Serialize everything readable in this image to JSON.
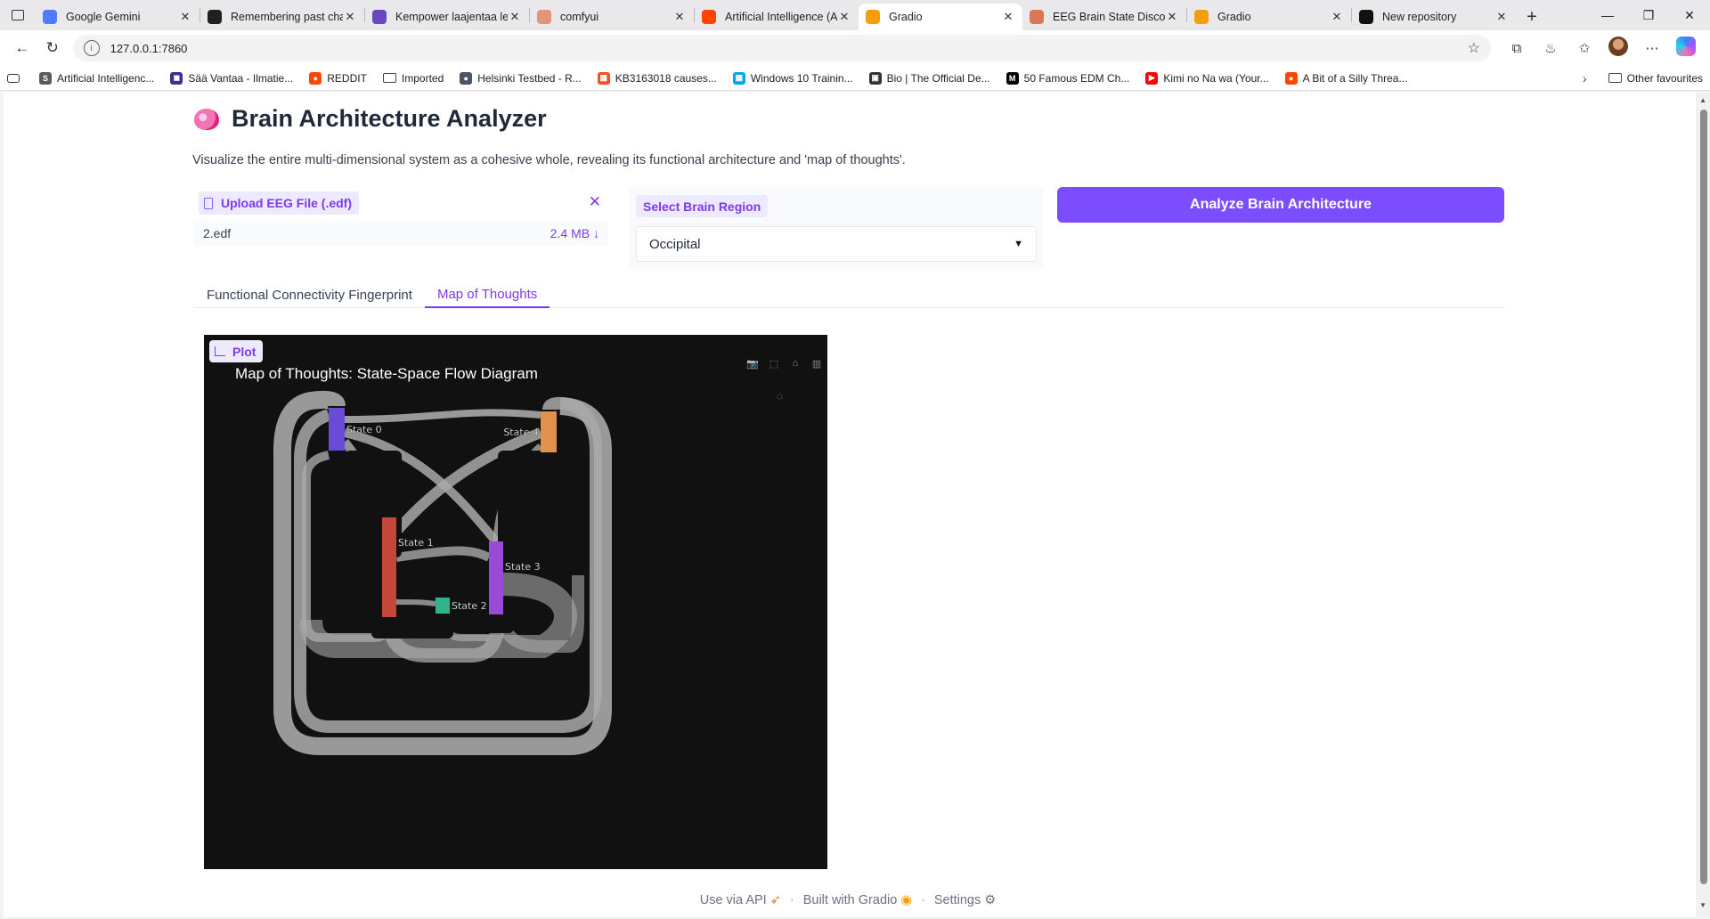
{
  "browser": {
    "tabs": [
      {
        "label": "Google Gemini",
        "icon": "gemini-icon",
        "color": "#4f7cff"
      },
      {
        "label": "Remembering past cha",
        "icon": "openai-icon",
        "color": "#202020"
      },
      {
        "label": "Kempower laajentaa le",
        "icon": "kempower-icon",
        "color": "#6b46c1"
      },
      {
        "label": "comfyui",
        "icon": "comfyui-icon",
        "color": "#e4947a"
      },
      {
        "label": "Artificial Intelligence (A",
        "icon": "reddit-icon",
        "color": "#ff4500"
      },
      {
        "label": "Gradio",
        "icon": "gradio-icon",
        "color": "#f59e0b",
        "active": true
      },
      {
        "label": "EEG Brain State Discove",
        "icon": "claude-icon",
        "color": "#d97757"
      },
      {
        "label": "Gradio",
        "icon": "gradio-icon",
        "color": "#f59e0b"
      },
      {
        "label": "New repository",
        "icon": "github-icon",
        "color": "#111111"
      }
    ],
    "url": "127.0.0.1:7860",
    "bookmarks": [
      {
        "label": "Artificial Intelligenc...",
        "color": "#5b5b5b",
        "glyph": "S"
      },
      {
        "label": "Sää Vantaa - Ilmatie...",
        "color": "#3b2f8f",
        "glyph": "◼"
      },
      {
        "label": "REDDIT",
        "color": "#ff4500",
        "glyph": "●"
      },
      {
        "label": "Imported",
        "color": "folder",
        "glyph": ""
      },
      {
        "label": "Helsinki Testbed - R...",
        "color": "#4b5563",
        "glyph": "●"
      },
      {
        "label": "KB3163018 causes...",
        "color": "#f25022",
        "glyph": "▦"
      },
      {
        "label": "Windows 10 Trainin...",
        "color": "#00a4ef",
        "glyph": "▦"
      },
      {
        "label": "Bio | The Official De...",
        "color": "#333333",
        "glyph": "▣"
      },
      {
        "label": "50 Famous EDM Ch...",
        "color": "#000000",
        "glyph": "M"
      },
      {
        "label": "Kimi no Na wa (Your...",
        "color": "#ff0000",
        "glyph": "▶"
      },
      {
        "label": "A Bit of a Silly Threa...",
        "color": "#ff4500",
        "glyph": "●"
      }
    ],
    "other_favourites": "Other favourites"
  },
  "app": {
    "title": "Brain Architecture Analyzer",
    "description": "Visualize the entire multi-dimensional system as a cohesive whole, revealing its functional architecture and 'map of thoughts'.",
    "upload": {
      "label": "Upload EEG File (.edf)",
      "file_name": "2.edf",
      "file_size": "2.4 MB ↓"
    },
    "region": {
      "label": "Select Brain Region",
      "value": "Occipital"
    },
    "analyze_button": "Analyze Brain Architecture",
    "tabs": [
      {
        "label": "Functional Connectivity Fingerprint",
        "active": false
      },
      {
        "label": "Map of Thoughts",
        "active": true
      }
    ],
    "plot_badge": "Plot"
  },
  "chart_data": {
    "type": "sankey",
    "title": "Map of Thoughts: State-Space Flow Diagram",
    "nodes": [
      {
        "label": "State 0",
        "color": "#6a4bd6"
      },
      {
        "label": "State 1",
        "color": "#c5473a"
      },
      {
        "label": "State 2",
        "color": "#2fb38a"
      },
      {
        "label": "State 3",
        "color": "#9a4bd6"
      },
      {
        "label": "State 4",
        "color": "#e0914a"
      }
    ],
    "links": [
      {
        "source": "State 0",
        "target": "State 0"
      },
      {
        "source": "State 0",
        "target": "State 1"
      },
      {
        "source": "State 0",
        "target": "State 3"
      },
      {
        "source": "State 0",
        "target": "State 4"
      },
      {
        "source": "State 1",
        "target": "State 1"
      },
      {
        "source": "State 1",
        "target": "State 2"
      },
      {
        "source": "State 1",
        "target": "State 3"
      },
      {
        "source": "State 2",
        "target": "State 2"
      },
      {
        "source": "State 3",
        "target": "State 3"
      },
      {
        "source": "State 3",
        "target": "State 1"
      },
      {
        "source": "State 4",
        "target": "State 4"
      },
      {
        "source": "State 4",
        "target": "State 0"
      },
      {
        "source": "State 4",
        "target": "State 1"
      }
    ],
    "background": "#111111",
    "link_color": "#a9a9a9"
  },
  "footer": {
    "api": "Use via API",
    "built": "Built with Gradio",
    "settings": "Settings"
  }
}
